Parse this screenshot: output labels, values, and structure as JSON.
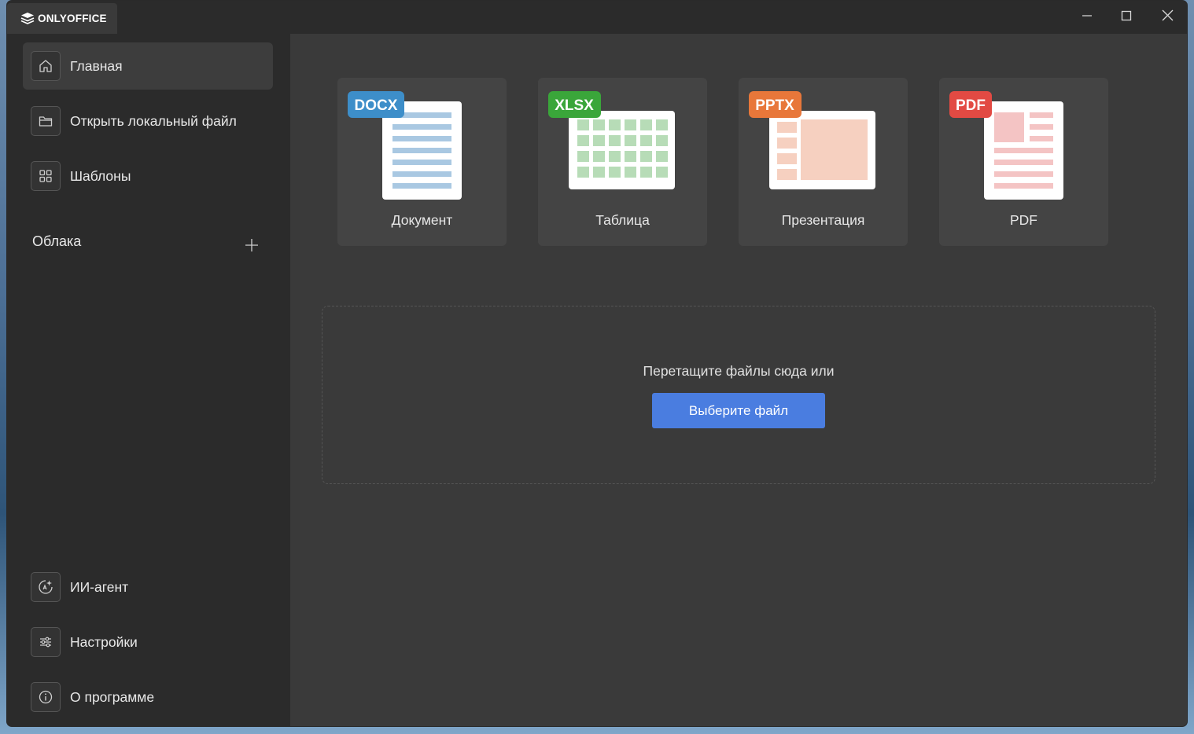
{
  "app": {
    "name": "ONLYOFFICE",
    "logo_icon": "onlyoffice-layers-icon"
  },
  "window_controls": {
    "minimize_icon": "minimize-icon",
    "maximize_icon": "maximize-icon",
    "close_icon": "close-icon"
  },
  "sidebar": {
    "top_items": [
      {
        "label": "Главная",
        "icon": "home-icon",
        "active": true
      },
      {
        "label": "Открыть локальный файл",
        "icon": "folder-icon",
        "active": false
      },
      {
        "label": "Шаблоны",
        "icon": "grid-icon",
        "active": false
      }
    ],
    "clouds": {
      "label": "Облака",
      "add_icon": "plus-icon"
    },
    "bottom_items": [
      {
        "label": "ИИ-агент",
        "icon": "ai-agent-icon"
      },
      {
        "label": "Настройки",
        "icon": "settings-sliders-icon"
      },
      {
        "label": "О программе",
        "icon": "info-icon"
      }
    ]
  },
  "create": {
    "tiles": [
      {
        "badge": "DOCX",
        "label": "Документ",
        "badge_color": "#3d8ec9",
        "accent_color": "#a9c8e2"
      },
      {
        "badge": "XLSX",
        "label": "Таблица",
        "badge_color": "#3aa63a",
        "accent_color": "#b7dcb7"
      },
      {
        "badge": "PPTX",
        "label": "Презентация",
        "badge_color": "#e8773a",
        "accent_color": "#f6d0c0"
      },
      {
        "badge": "PDF",
        "label": "PDF",
        "badge_color": "#e24a43",
        "accent_color": "#f4c4c4"
      }
    ]
  },
  "dropzone": {
    "text": "Перетащите файлы сюда или",
    "button_label": "Выберите файл",
    "button_color": "#4a7de0"
  },
  "colors": {
    "sidebar_bg": "#2b2b2b",
    "main_bg": "#3a3a3a",
    "tile_bg": "#444444"
  }
}
